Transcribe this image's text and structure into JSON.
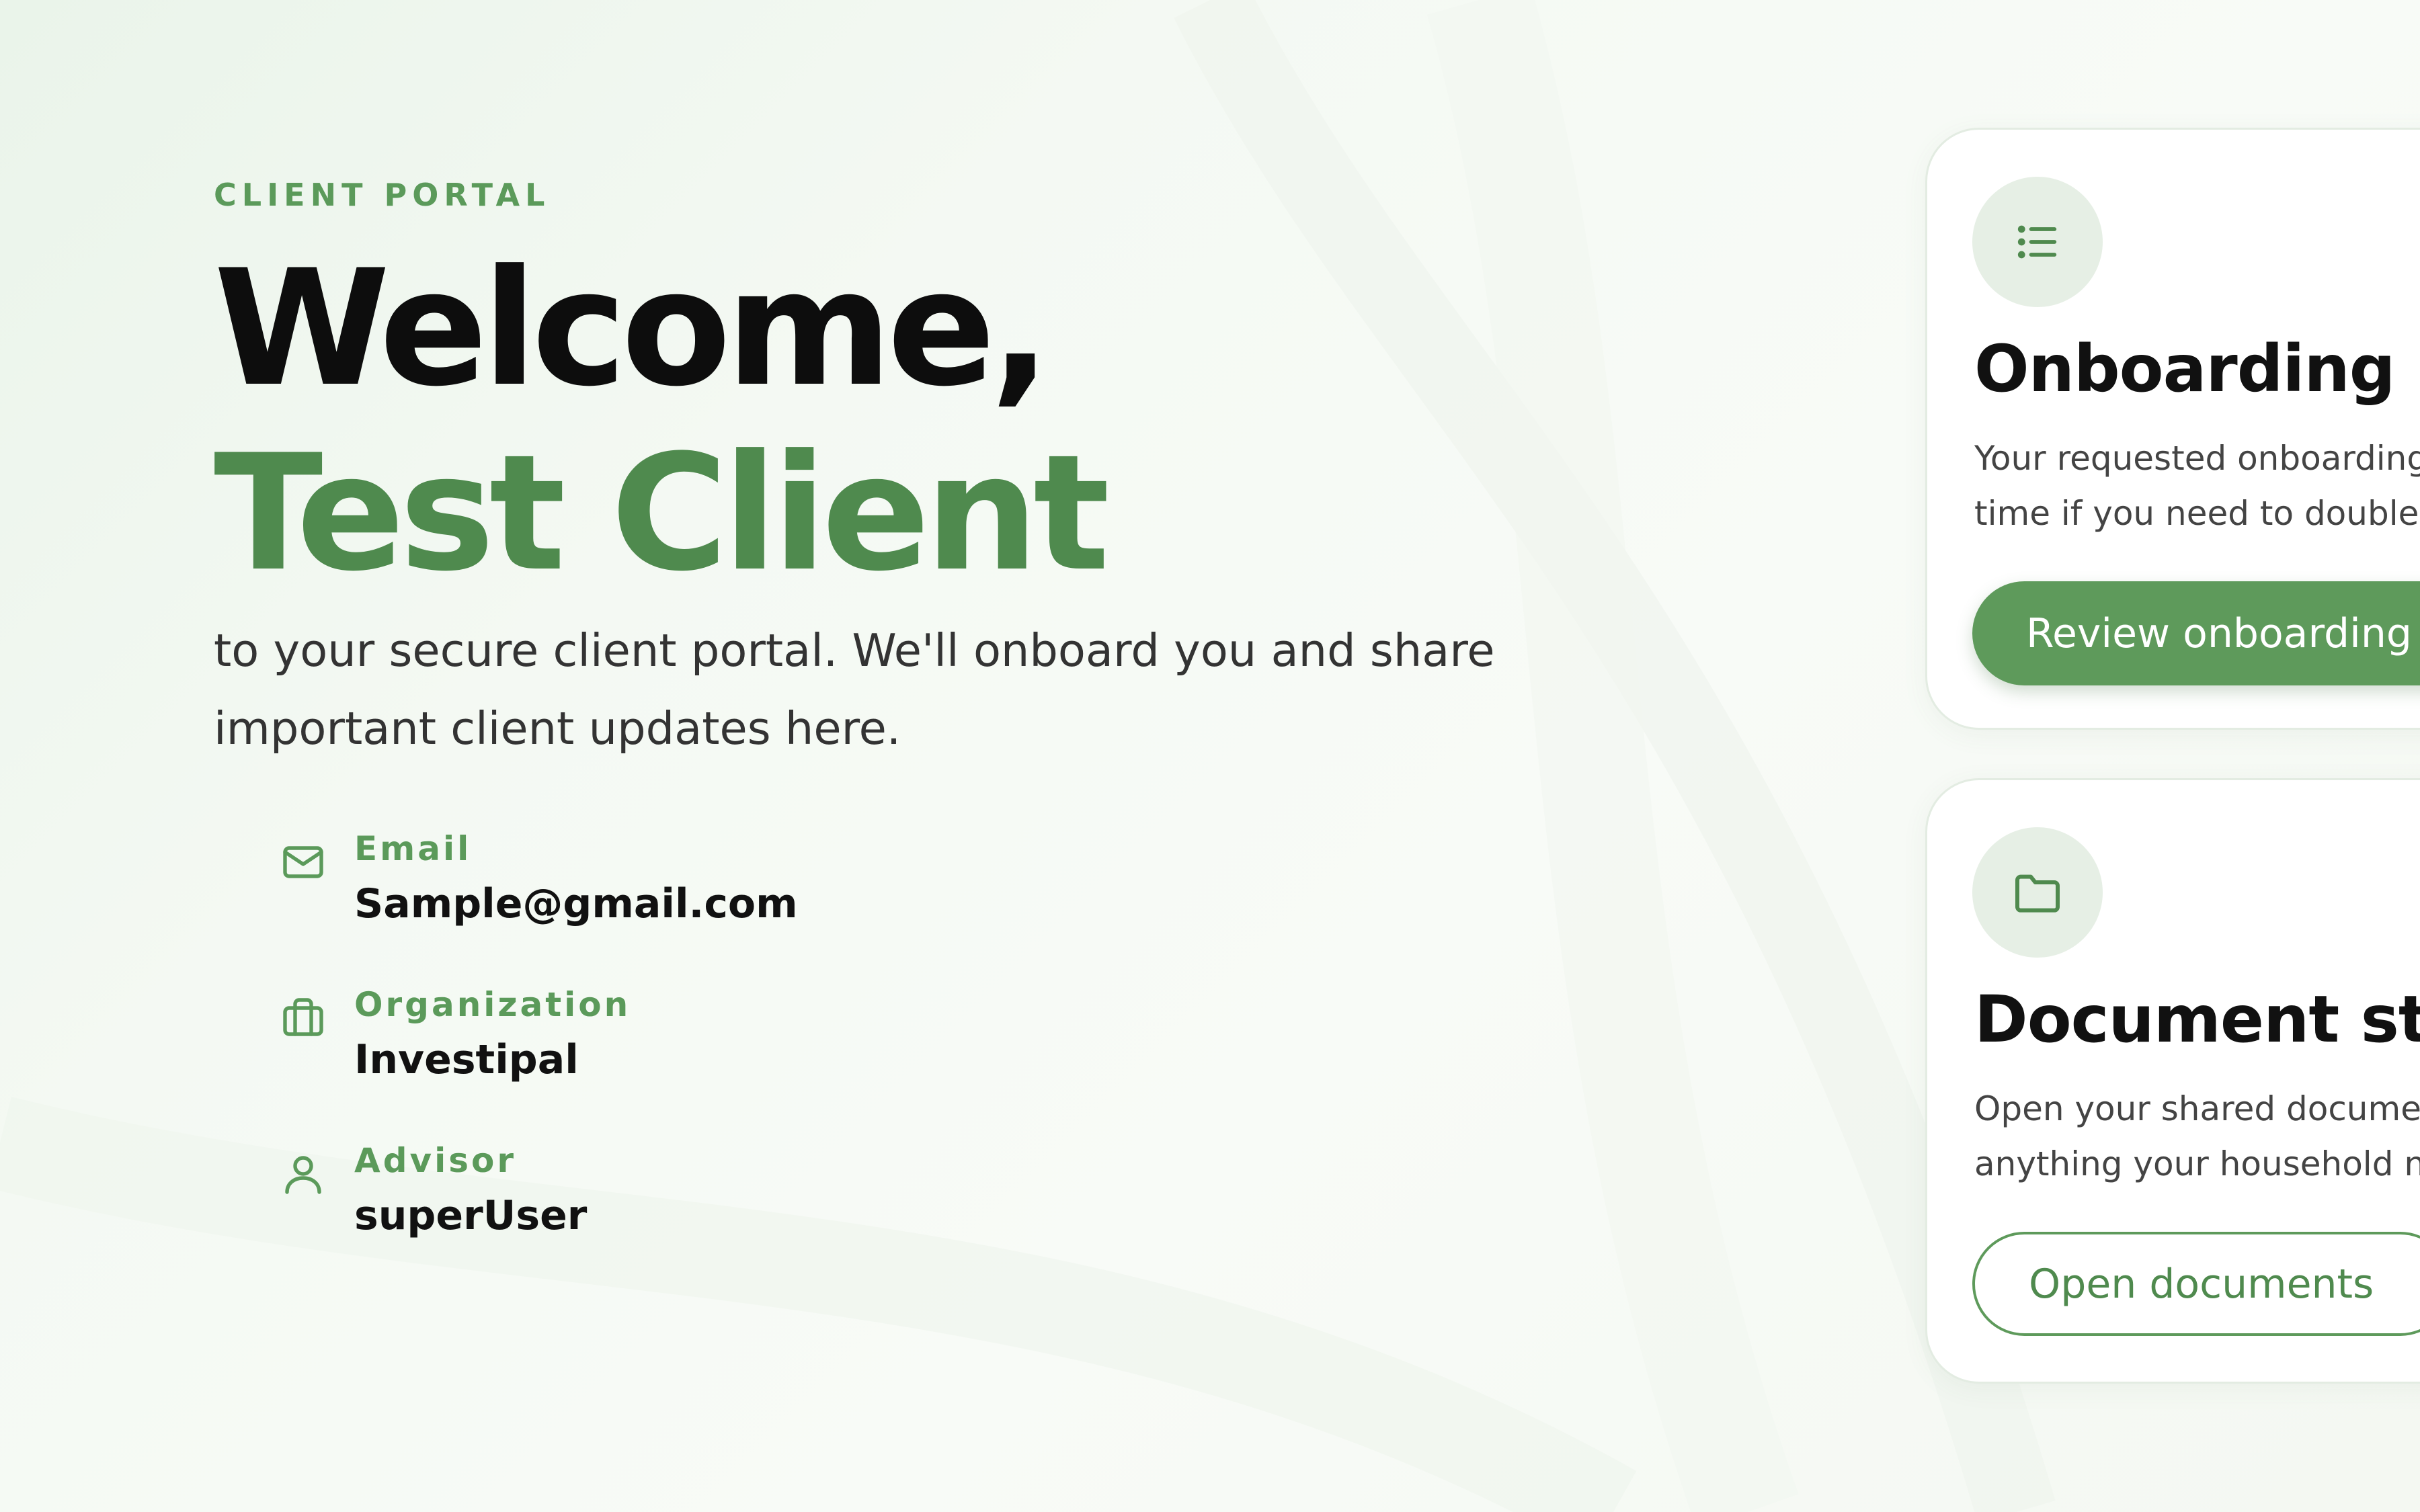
{
  "hero": {
    "eyebrow": "CLIENT PORTAL",
    "greeting": "Welcome,",
    "client_name": "Test Client",
    "intro": "to your secure client portal. We'll onboard you and share important client updates here."
  },
  "details": [
    {
      "icon": "mail-icon",
      "label": "Email",
      "value": "Sample@gmail.com"
    },
    {
      "icon": "briefcase-icon",
      "label": "Organization",
      "value": "Investipal"
    },
    {
      "icon": "user-icon",
      "label": "Advisor",
      "value": "superUser"
    }
  ],
  "cards": {
    "onboarding": {
      "icon": "list-icon",
      "title": "Onboarding",
      "description_lines": [
        "Your requested onboarding",
        "time if you need to double"
      ],
      "button_label": "Review onboarding"
    },
    "documents": {
      "icon": "folder-icon",
      "title": "Document sto",
      "description_lines": [
        "Open your shared docume",
        "anything your household n"
      ],
      "button_label": "Open documents"
    }
  },
  "colors": {
    "accent": "#5e9a5b",
    "accent_dark": "#4f8a4e",
    "heading": "#0d0d0d"
  }
}
